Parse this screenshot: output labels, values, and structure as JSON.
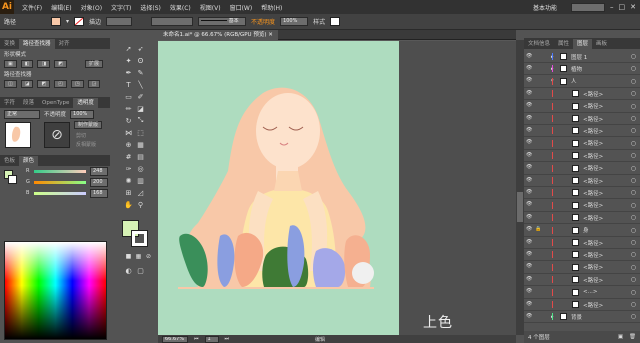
{
  "app": {
    "logo": "Ai"
  },
  "menu": [
    "文件(F)",
    "编辑(E)",
    "对象(O)",
    "文字(T)",
    "选择(S)",
    "效果(C)",
    "视图(V)",
    "窗口(W)",
    "帮助(H)"
  ],
  "workspace": {
    "label": "基本功能",
    "search_placeholder": ""
  },
  "controlbar": {
    "selection": "路径",
    "stroke_label": "描边",
    "stroke_style": "基本",
    "opacity_label": "不透明度",
    "opacity_value": "100%",
    "style_label": "样式"
  },
  "left_panel": {
    "tabs1": [
      "变换",
      "路径查找器",
      "对齐"
    ],
    "shape_modes_label": "形状模式",
    "expand_label": "扩展",
    "pathfinder_label": "路径查找器",
    "tabs2": [
      "字符",
      "段落",
      "OpenType",
      "透明度"
    ],
    "blend_mode": "正常",
    "opacity_label": "不透明度",
    "opacity_value": "100%",
    "make_mask": "制作蒙版",
    "clip": "剪切",
    "invert_mask": "反相蒙版",
    "tabs3": [
      "色板",
      "颜色"
    ],
    "color_channels": [
      {
        "label": "R",
        "value": "248"
      },
      {
        "label": "G",
        "value": "200"
      },
      {
        "label": "B",
        "value": "168"
      }
    ]
  },
  "document": {
    "tab_title": "未命名1.ai* @ 66.67% (RGB/GPU 预览)",
    "caption": "上色"
  },
  "statusbar": {
    "zoom": "66.67%",
    "page": "1",
    "mode": "编辑"
  },
  "layers_panel": {
    "tabs": [
      "文档信息",
      "属性",
      "图层",
      "画板"
    ],
    "rows": [
      {
        "name": "图层 1",
        "indent": 0,
        "color": "#4f7bff",
        "expand": "▸"
      },
      {
        "name": "植物",
        "indent": 0,
        "color": "#e24ad9",
        "expand": "▸"
      },
      {
        "name": "人",
        "indent": 0,
        "color": "#e24a4a",
        "expand": "▾"
      },
      {
        "name": "<路径>",
        "indent": 1,
        "color": "#e24a4a"
      },
      {
        "name": "<路径>",
        "indent": 1,
        "color": "#e24a4a"
      },
      {
        "name": "<路径>",
        "indent": 1,
        "color": "#e24a4a"
      },
      {
        "name": "<路径>",
        "indent": 1,
        "color": "#e24a4a"
      },
      {
        "name": "<路径>",
        "indent": 1,
        "color": "#e24a4a"
      },
      {
        "name": "<路径>",
        "indent": 1,
        "color": "#e24a4a"
      },
      {
        "name": "<路径>",
        "indent": 1,
        "color": "#e24a4a"
      },
      {
        "name": "<路径>",
        "indent": 1,
        "color": "#e24a4a"
      },
      {
        "name": "<路径>",
        "indent": 1,
        "color": "#e24a4a"
      },
      {
        "name": "<路径>",
        "indent": 1,
        "color": "#e24a4a"
      },
      {
        "name": "<路径>",
        "indent": 1,
        "color": "#e24a4a"
      },
      {
        "name": "身",
        "indent": 1,
        "color": "#e24a4a",
        "locked": true
      },
      {
        "name": "<路径>",
        "indent": 1,
        "color": "#e24a4a"
      },
      {
        "name": "<路径>",
        "indent": 1,
        "color": "#e24a4a"
      },
      {
        "name": "<路径>",
        "indent": 1,
        "color": "#e24a4a"
      },
      {
        "name": "<路径>",
        "indent": 1,
        "color": "#e24a4a"
      },
      {
        "name": "<...>",
        "indent": 1,
        "color": "#e24a4a"
      },
      {
        "name": "<路径>",
        "indent": 1,
        "color": "#e24a4a"
      },
      {
        "name": "背景",
        "indent": 0,
        "color": "#4fe28a",
        "expand": "▸"
      }
    ],
    "footer": "4 个图层"
  },
  "colors": {
    "fill": "#f8c8a8",
    "accent": "#f7941d",
    "artboard": "#aedcbf"
  }
}
